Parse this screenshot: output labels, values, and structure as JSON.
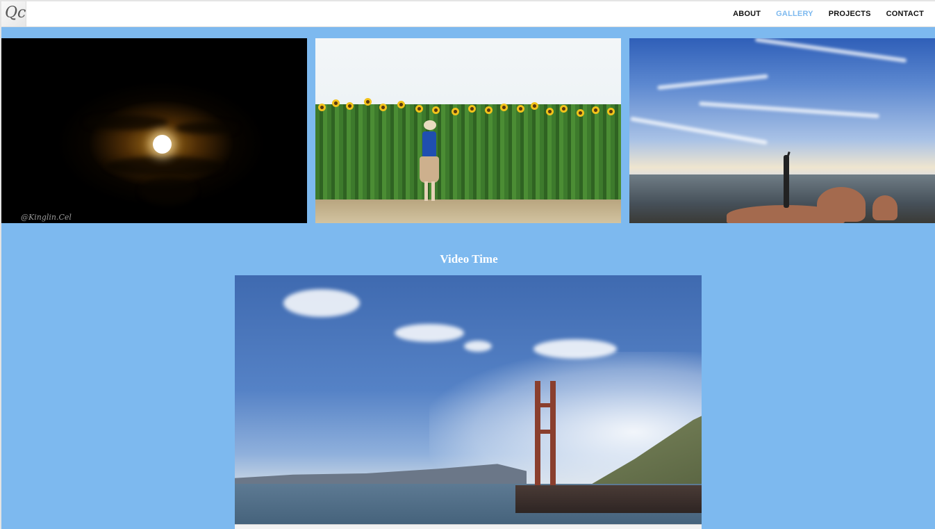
{
  "header": {
    "logo_text": "Qc",
    "nav": [
      {
        "label": "ABOUT",
        "active": false
      },
      {
        "label": "GALLERY",
        "active": true
      },
      {
        "label": "PROJECTS",
        "active": false
      },
      {
        "label": "CONTACT",
        "active": false
      }
    ]
  },
  "gallery": {
    "photos": [
      {
        "subject": "full moon behind clouds",
        "watermark": "@Kinglin.Cel"
      },
      {
        "subject": "woman photographing sunflower field"
      },
      {
        "subject": "hiker on rocky summit under cloudy sky"
      }
    ]
  },
  "video": {
    "title": "Video Time",
    "subject": "Golden Gate Bridge in fog"
  },
  "colors": {
    "page_background": "#7db9ef",
    "active_nav": "#7db9ef",
    "nav_text": "#111111",
    "header_background": "#ffffff"
  }
}
